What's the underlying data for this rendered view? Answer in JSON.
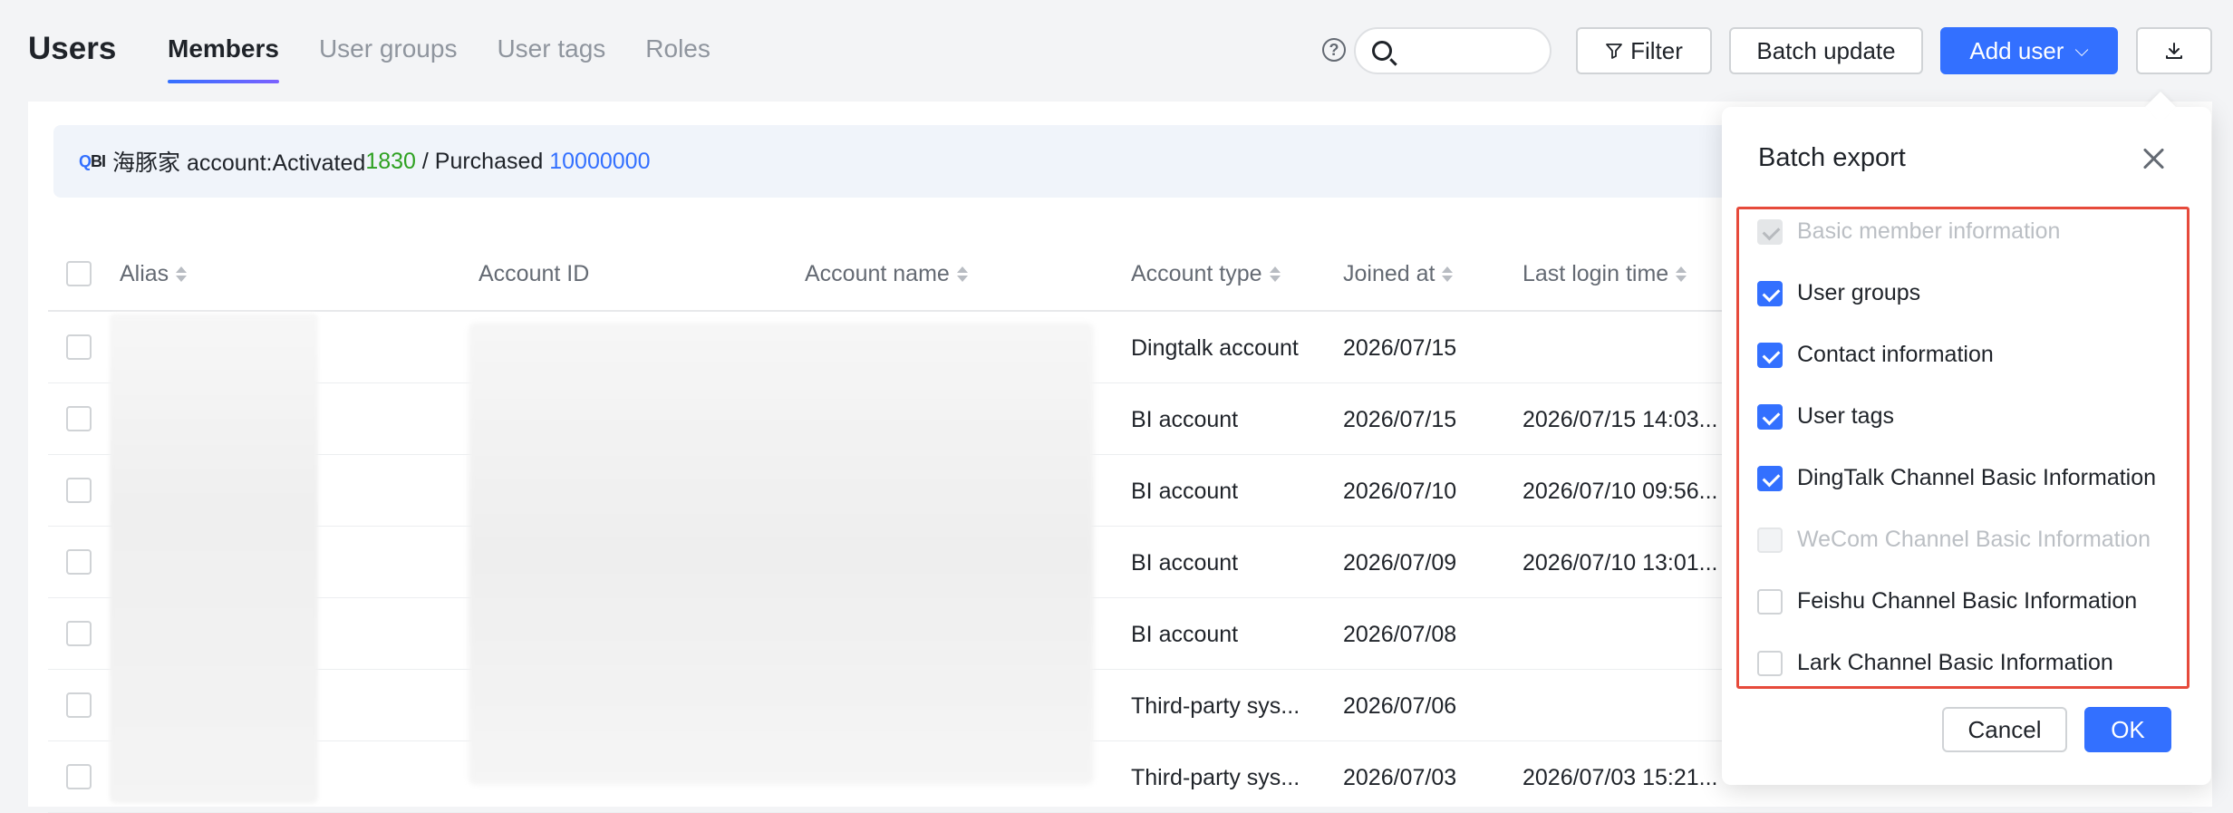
{
  "header": {
    "title": "Users",
    "tabs": [
      {
        "label": "Members",
        "active": true
      },
      {
        "label": "User groups",
        "active": false
      },
      {
        "label": "User tags",
        "active": false
      },
      {
        "label": "Roles",
        "active": false
      }
    ],
    "help_icon": "?",
    "search_placeholder": "",
    "filter_label": "Filter",
    "batch_update_label": "Batch update",
    "add_user_label": "Add user",
    "add_user_chevron": "⌵"
  },
  "banner": {
    "logo_q": "Q",
    "logo_bi": "BI",
    "prefix": "海豚家 account:Activated ",
    "activated": "1830",
    "separator": " / Purchased ",
    "purchased": "10000000"
  },
  "table": {
    "columns": [
      "Alias",
      "Account ID",
      "Account name",
      "Account type",
      "Joined at",
      "Last login time"
    ],
    "rows": [
      {
        "account_type": "Dingtalk account",
        "joined_at": "2026/07/15",
        "last_login": ""
      },
      {
        "account_type": "BI account",
        "joined_at": "2026/07/15",
        "last_login": "2026/07/15 14:03..."
      },
      {
        "account_type": "BI account",
        "joined_at": "2026/07/10",
        "last_login": "2026/07/10 09:56..."
      },
      {
        "account_type": "BI account",
        "joined_at": "2026/07/09",
        "last_login": "2026/07/10 13:01..."
      },
      {
        "account_type": "BI account",
        "joined_at": "2026/07/08",
        "last_login": ""
      },
      {
        "account_type": "Third-party sys...",
        "joined_at": "2026/07/06",
        "last_login": ""
      },
      {
        "account_type": "Third-party sys...",
        "joined_at": "2026/07/03",
        "last_login": "2026/07/03 15:21..."
      }
    ]
  },
  "dialog": {
    "title": "Batch export",
    "options": [
      {
        "label": "Basic member information",
        "state": "disabled-checked"
      },
      {
        "label": "User groups",
        "state": "checked"
      },
      {
        "label": "Contact information",
        "state": "checked"
      },
      {
        "label": "User tags",
        "state": "checked"
      },
      {
        "label": "DingTalk Channel Basic Information",
        "state": "checked"
      },
      {
        "label": "WeCom Channel Basic Information",
        "state": "disabled"
      },
      {
        "label": "Feishu Channel Basic Information",
        "state": "unchecked"
      },
      {
        "label": "Lark Channel Basic Information",
        "state": "unchecked"
      }
    ],
    "cancel_label": "Cancel",
    "ok_label": "OK"
  },
  "colors": {
    "primary": "#3370ff",
    "success": "#2ea121",
    "highlight_border": "#e64a3b"
  }
}
